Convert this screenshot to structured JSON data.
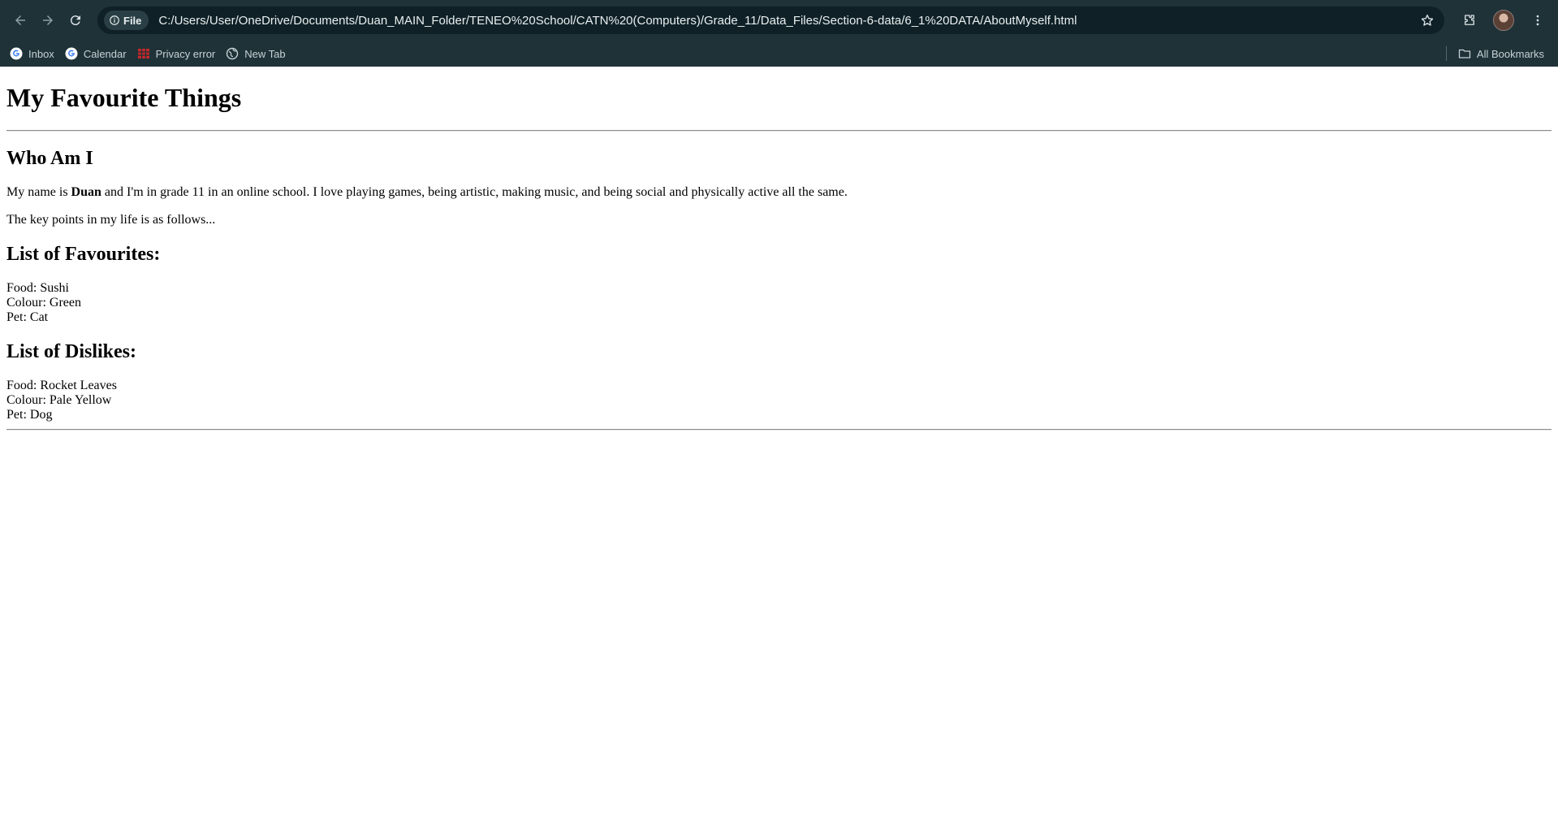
{
  "browser": {
    "chip_label": "File",
    "url": "C:/Users/User/OneDrive/Documents/Duan_MAIN_Folder/TENEO%20School/CATN%20(Computers)/Grade_11/Data_Files/Section-6-data/6_1%20DATA/AboutMyself.html",
    "bookmarks": [
      {
        "label": "Inbox",
        "icon": "google-icon"
      },
      {
        "label": "Calendar",
        "icon": "google-icon"
      },
      {
        "label": "Privacy error",
        "icon": "error-grid-icon"
      },
      {
        "label": "New Tab",
        "icon": "globe-icon"
      }
    ],
    "all_bookmarks_label": "All Bookmarks",
    "colors": {
      "chrome": "#1f3238",
      "omnibox": "#0f2126"
    }
  },
  "page": {
    "title": "My Favourite Things",
    "who_heading": "Who Am I",
    "intro_before": "My name is ",
    "intro_name": "Duan",
    "intro_after": " and I'm in grade 11 in an online school. I love playing games, being artistic, making music, and being social and physically active all the same.",
    "key_points": "The key points in my life is as follows...",
    "favourites_heading": "List of Favourites:",
    "favourites": [
      "Food: Sushi",
      "Colour: Green",
      "Pet: Cat"
    ],
    "dislikes_heading": "List of Dislikes:",
    "dislikes": [
      "Food: Rocket Leaves",
      "Colour: Pale Yellow",
      "Pet: Dog"
    ]
  }
}
